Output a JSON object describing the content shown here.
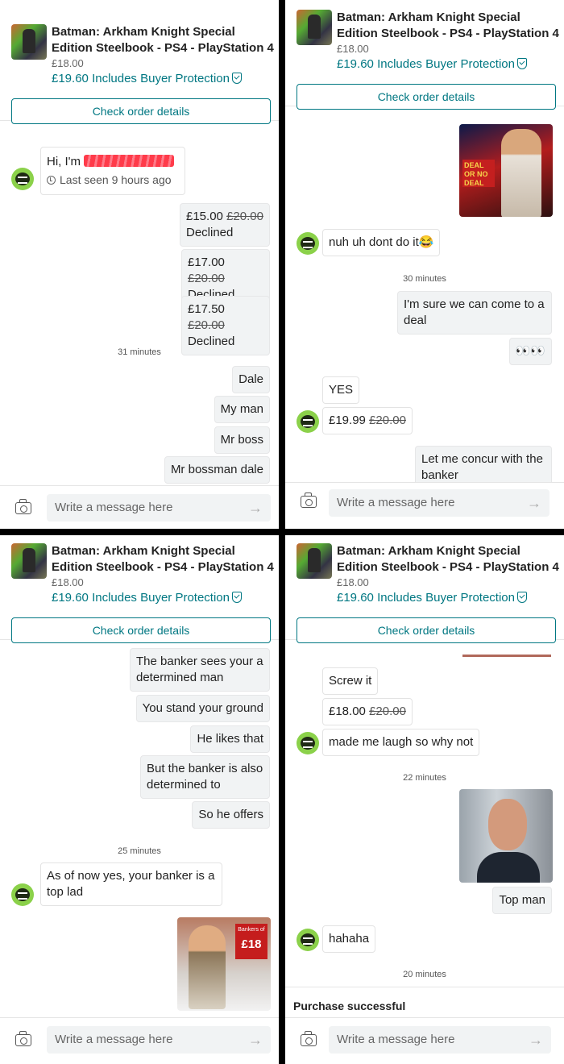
{
  "listing": {
    "title": "Batman: Arkham Knight Special Edition Steelbook - PS4 - PlayStation 4",
    "price": "£18.00",
    "total_price": "£19.60",
    "protection": "Includes Buyer Protection",
    "order_button": "Check order details"
  },
  "composer": {
    "placeholder": "Write a message here",
    "send_icon": "arrow-right-icon",
    "camera_icon": "camera-icon"
  },
  "panel1": {
    "profile_greeting": "Hi, I'm",
    "last_seen": "Last seen 9 hours ago",
    "offers": [
      {
        "price": "£15.00",
        "original": "£20.00",
        "status": "Declined"
      },
      {
        "price": "£17.00",
        "original": "£20.00",
        "status": "Declined"
      },
      {
        "price": "£17.50",
        "original": "£20.00",
        "status": "Declined"
      }
    ],
    "timestamp": "31 minutes",
    "messages": [
      "Dale",
      "My man",
      "Mr boss",
      "Mr bossman dale"
    ]
  },
  "panel2": {
    "image_sign": "DEAL OR NO DEAL",
    "reply1": "nuh uh dont do it😂",
    "timestamp": "30 minutes",
    "msg1": "I'm sure we can come to a deal",
    "msg2": "👀👀",
    "reply2": "YES",
    "offer": {
      "price": "£19.99",
      "original": "£20.00"
    },
    "msg3": "Let me concur with the banker"
  },
  "panel3": {
    "messages": [
      "The banker sees your a determined man",
      "You stand your ground",
      "He likes that",
      "But the banker is also determined to",
      "So he offers"
    ],
    "timestamp": "25 minutes",
    "reply": "As of now yes, your banker is a top lad",
    "image_banner_label": "Bankers of",
    "image_banner_price": "£18"
  },
  "panel4": {
    "reply1": "Screw it",
    "offer": {
      "price": "£18.00",
      "original": "£20.00"
    },
    "reply2": "made me laugh so why not",
    "timestamp1": "22 minutes",
    "msg1": "Top man",
    "reply3": "hahaha",
    "timestamp2": "20 minutes",
    "purchase": "Purchase successful"
  },
  "colors": {
    "accent": "#007782",
    "bubble": "#f1f3f4"
  }
}
